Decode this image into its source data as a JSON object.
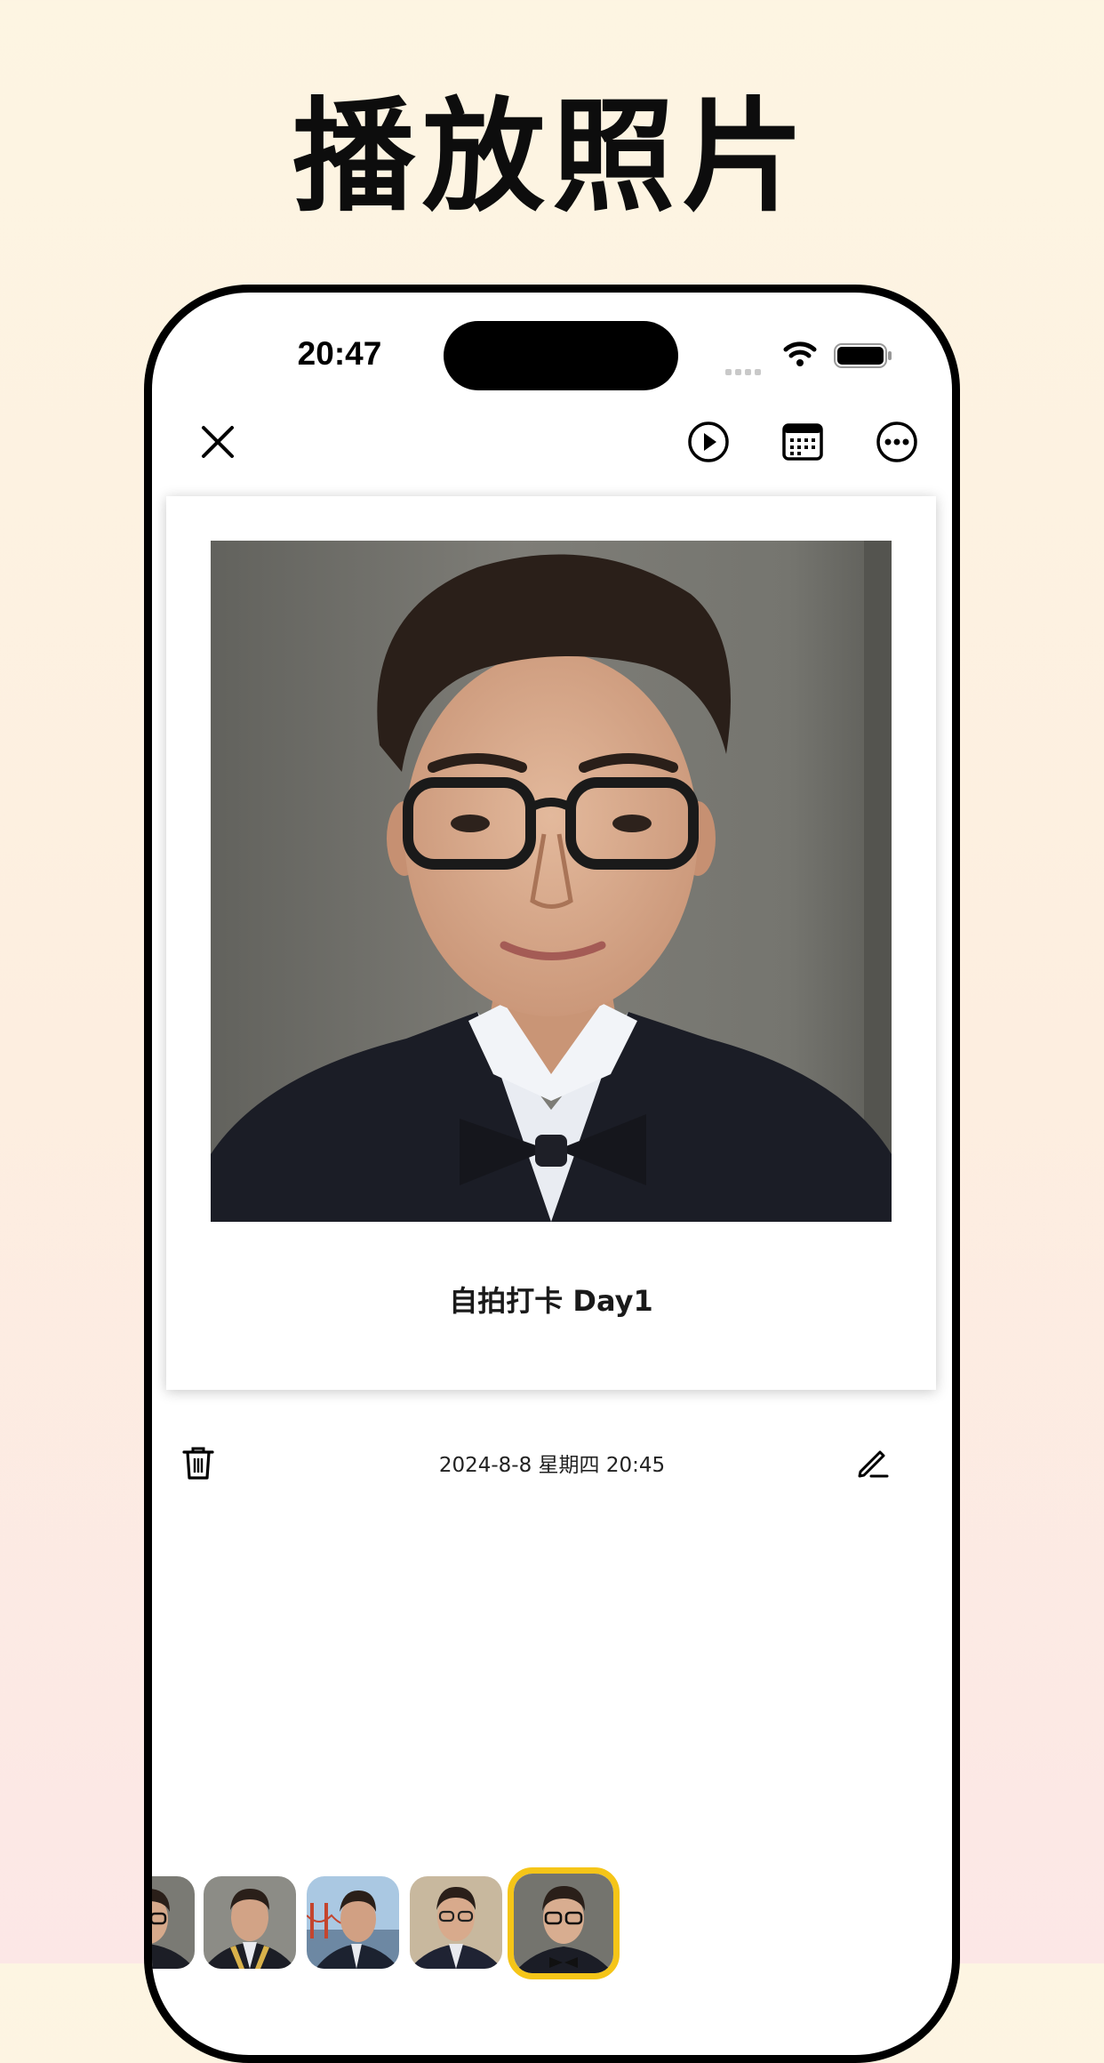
{
  "headline": "播放照片",
  "status_bar": {
    "time": "20:47"
  },
  "toolbar": {
    "close_icon": "close-icon",
    "play_icon": "play-circle-icon",
    "calendar_icon": "calendar-icon",
    "more_icon": "more-circle-icon"
  },
  "card": {
    "caption": "自拍打卡  Day1"
  },
  "entry": {
    "date": "2024-8-8 星期四 20:45",
    "delete_icon": "trash-icon",
    "edit_icon": "pencil-icon"
  },
  "thumbnails": [
    {
      "background": "gray-wall",
      "selected": false
    },
    {
      "background": "gray-wall-sash",
      "selected": false
    },
    {
      "background": "golden-gate-bridge",
      "selected": false
    },
    {
      "background": "beige-wall",
      "selected": false
    },
    {
      "background": "gray-wall-bowtie",
      "selected": true
    }
  ],
  "colors": {
    "accent_selected": "#f5c518",
    "page_bg_top": "#fdf5e2",
    "page_bg_bottom": "#fce7e6"
  }
}
